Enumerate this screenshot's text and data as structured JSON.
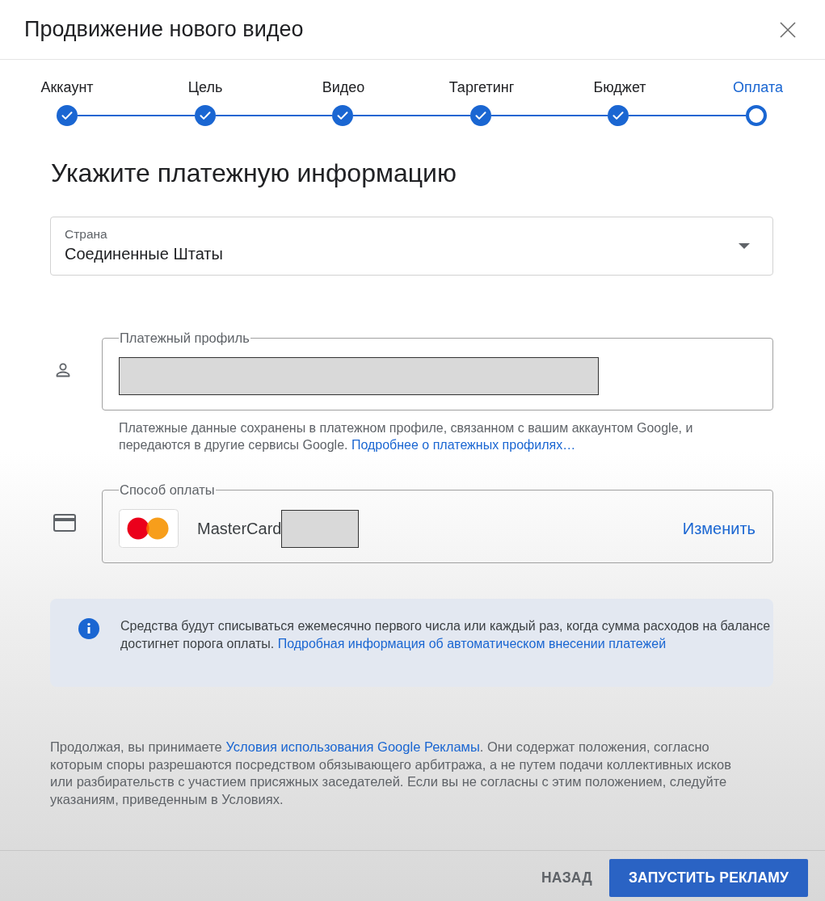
{
  "dialog": {
    "title": "Продвижение нового видео"
  },
  "steps": [
    {
      "label": "Аккаунт",
      "done": true,
      "selected": false
    },
    {
      "label": "Цель",
      "done": true,
      "selected": false
    },
    {
      "label": "Видео",
      "done": true,
      "selected": false
    },
    {
      "label": "Таргетинг",
      "done": true,
      "selected": false
    },
    {
      "label": "Бюджет",
      "done": true,
      "selected": false
    },
    {
      "label": "Оплата",
      "done": false,
      "selected": true
    }
  ],
  "heading": "Укажите платежную информацию",
  "country_select": {
    "label": "Страна",
    "value": "Соединенные Штаты"
  },
  "payment_profile": {
    "legend": "Платежный профиль",
    "redacted": true,
    "note": {
      "text": "Платежные данные сохранены в платежном профиле, связанном с вашим аккаунтом Google, и передаются в другие сервисы Google. ",
      "link": "Подробнее о платежных профилях…"
    }
  },
  "payment_method": {
    "legend": "Способ оплаты",
    "card_name": "MasterCard",
    "redacted": true,
    "action": "Изменить"
  },
  "info_notice": {
    "text": "Средства будут списываться ежемесячно первого числа или каждый раз, когда сумма расходов на балансе достигнет порога оплаты. ",
    "link": "Подробная информация об автоматическом внесении платежей"
  },
  "terms": {
    "before": "Продолжая, вы принимаете ",
    "link": "Условия использования Google Рекламы",
    "after": ". Они содержат положения, согласно которым споры разрешаются посредством обязывающего арбитража, а не путем подачи коллективных исков или разбирательств с участием присяжных заседателей. Если вы не согласны с этим положением, следуйте указаниям, приведенным в Условиях."
  },
  "buttons": [
    {
      "label": "НАЗАД",
      "kind": "text"
    },
    {
      "label": "ЗАПУСТИТЬ РЕКЛАМУ",
      "kind": "primary"
    }
  ]
}
